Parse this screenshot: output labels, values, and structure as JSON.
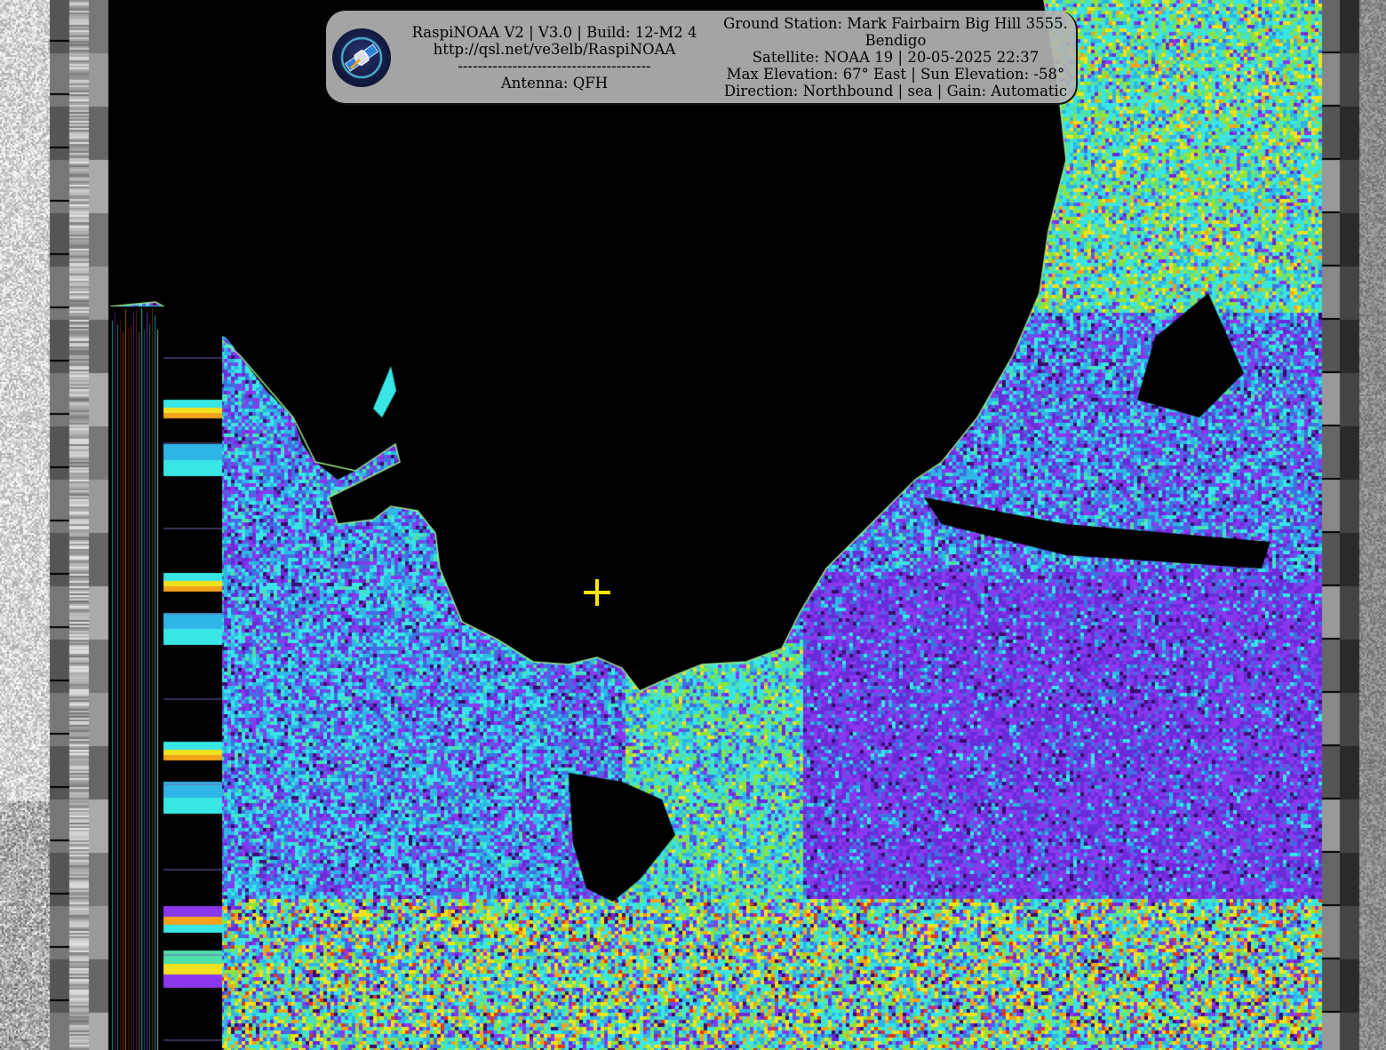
{
  "overlay": {
    "left_lines": [
      "RaspiNOAA V2 | V3.0 | Build: 12-M2 4",
      "http://qsl.net/ve3elb/RaspiNOAA",
      "---------------------------------------",
      "Antenna: QFH"
    ],
    "right_lines": [
      "Ground Station: Mark Fairbairn Big Hill 3555.",
      "Bendigo",
      "Satellite: NOAA 19 | 20-05-2025 22:37",
      "Max Elevation: 67° East | Sun Elevation: -58°",
      "Direction: Northbound | sea | Gain: Automatic"
    ]
  },
  "colors": {
    "crosshair": "#ffe600",
    "land": "#000000",
    "palette": [
      "#3a0a6e",
      "#6a2bd8",
      "#8a38ee",
      "#3f6fe0",
      "#2fb6e6",
      "#39e6e6",
      "#4ee0a8",
      "#8ee33c",
      "#f0e21f",
      "#f4a21a",
      "#e03a10"
    ]
  },
  "icons": {
    "logo": "satellite-logo-icon",
    "marker": "ground-station-crosshair-icon"
  }
}
